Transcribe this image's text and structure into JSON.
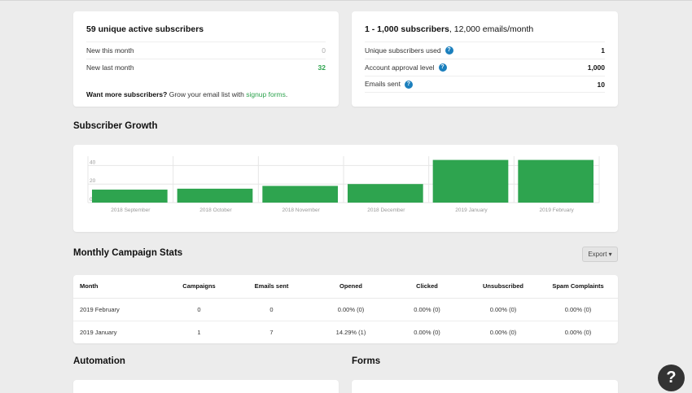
{
  "summary_left": {
    "title_strong": "59 unique active subscribers",
    "rows": [
      {
        "label": "New this month",
        "value": "0"
      },
      {
        "label": "New last month",
        "value": "32"
      }
    ],
    "promo_strong": "Want more subscribers?",
    "promo_text": " Grow your email list with ",
    "promo_link": "signup forms",
    "promo_end": "."
  },
  "summary_right": {
    "title_strong": "1 - 1,000 subscribers",
    "title_rest": ", 12,000 emails/month",
    "rows": [
      {
        "label": "Unique subscribers used",
        "value": "1"
      },
      {
        "label": "Account approval level",
        "value": "1,000"
      },
      {
        "label": "Emails sent",
        "value": "10"
      }
    ],
    "help_glyph": "?"
  },
  "growth": {
    "title": "Subscriber Growth"
  },
  "chart_data": {
    "type": "bar",
    "categories": [
      "2018 September",
      "2018 October",
      "2018 November",
      "2018 December",
      "2019 January",
      "2019 February"
    ],
    "values": [
      14,
      15,
      18,
      20,
      46,
      46
    ],
    "y_ticks": [
      "0",
      "20",
      "40"
    ],
    "ylim": [
      0,
      50
    ],
    "grid": true,
    "bar_color": "#2ea44f",
    "title": "",
    "xlabel": "",
    "ylabel": ""
  },
  "campaign_stats": {
    "title": "Monthly Campaign Stats",
    "export_label": "Export ▾",
    "columns": [
      "Month",
      "Campaigns",
      "Emails sent",
      "Opened",
      "Clicked",
      "Unsubscribed",
      "Spam Complaints"
    ],
    "rows": [
      [
        "2019 February",
        "0",
        "0",
        "0.00% (0)",
        "0.00% (0)",
        "0.00% (0)",
        "0.00% (0)"
      ],
      [
        "2019 January",
        "1",
        "7",
        "14.29% (1)",
        "0.00% (0)",
        "0.00% (0)",
        "0.00% (0)"
      ]
    ]
  },
  "automation": {
    "title": "Automation"
  },
  "forms": {
    "title": "Forms"
  },
  "help_fab": {
    "glyph": "?"
  },
  "colors": {
    "accent": "#2ea44f",
    "help_blue": "#1b7fbd",
    "background": "#ececec"
  }
}
